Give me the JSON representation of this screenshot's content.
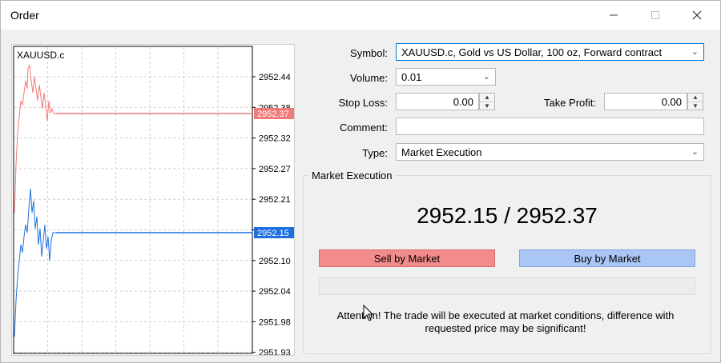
{
  "window": {
    "title": "Order"
  },
  "chart": {
    "symbol": "XAUUSD.c",
    "price_labels": [
      "2952.44",
      "2952.38",
      "2952.32",
      "2952.27",
      "2952.21",
      "2952.15",
      "2952.10",
      "2952.04",
      "2951.98",
      "2951.93"
    ],
    "ask_tag": "2952.37",
    "bid_tag": "2952.15",
    "ask_color": "#f07a7a",
    "bid_color": "#1f6fe0"
  },
  "form": {
    "symbol_label": "Symbol:",
    "symbol_value": "XAUUSD.c, Gold vs US Dollar, 100 oz, Forward contract",
    "volume_label": "Volume:",
    "volume_value": "0.01",
    "stop_loss_label": "Stop Loss:",
    "stop_loss_value": "0.00",
    "take_profit_label": "Take Profit:",
    "take_profit_value": "0.00",
    "comment_label": "Comment:",
    "comment_value": "",
    "type_label": "Type:",
    "type_value": "Market Execution"
  },
  "execution": {
    "group_title": "Market Execution",
    "prices": "2952.15 / 2952.37",
    "sell_label": "Sell by Market",
    "buy_label": "Buy by Market",
    "attention_line1": "Attention! The trade will be executed at market conditions, difference with",
    "attention_line2": "requested price may be significant!",
    "sell_color": "#f28b8b",
    "buy_color": "#a9c6f5"
  }
}
